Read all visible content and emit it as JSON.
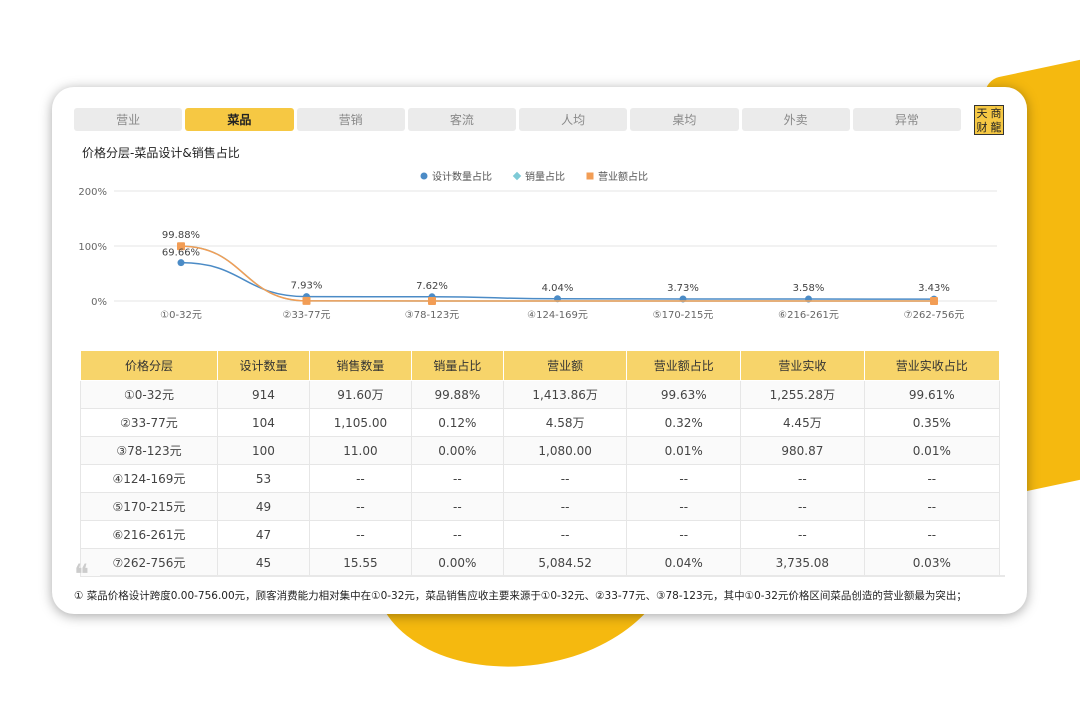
{
  "tabs": [
    "营业",
    "菜品",
    "营销",
    "客流",
    "人均",
    "桌均",
    "外卖",
    "异常"
  ],
  "active_tab": "菜品",
  "logo": [
    "天",
    "商",
    "财",
    "龍"
  ],
  "section_title": "价格分层-菜品设计&销售占比",
  "chart_data": {
    "type": "line",
    "categories": [
      "①0-32元",
      "②33-77元",
      "③78-123元",
      "④124-169元",
      "⑤170-215元",
      "⑥216-261元",
      "⑦262-756元"
    ],
    "series": [
      {
        "name": "设计数量占比",
        "type": "line",
        "color": "#4b8bc6",
        "values": [
          69.66,
          7.93,
          7.62,
          4.04,
          3.73,
          3.58,
          3.43
        ],
        "labels": [
          "69.66%",
          "7.93%",
          "7.62%",
          "4.04%",
          "3.73%",
          "3.58%",
          "3.43%"
        ]
      },
      {
        "name": "销量占比",
        "type": "line",
        "color": "#7ecad6",
        "values": [
          99.88,
          0.12,
          0.0,
          null,
          null,
          null,
          0.0
        ]
      },
      {
        "name": "营业额占比",
        "type": "line",
        "color": "#f29d55",
        "values": [
          99.63,
          0.32,
          0.01,
          null,
          null,
          null,
          0.04
        ],
        "labels": [
          "99.88%"
        ]
      }
    ],
    "yticks": [
      "200%",
      "100%",
      "0%"
    ],
    "ylim": [
      0,
      200
    ],
    "legend_position": "top-center"
  },
  "table": {
    "headers": [
      "价格分层",
      "设计数量",
      "销售数量",
      "销量占比",
      "营业额",
      "营业额占比",
      "营业实收",
      "营业实收占比"
    ],
    "rows": [
      [
        "①0-32元",
        "914",
        "91.60万",
        "99.88%",
        "1,413.86万",
        "99.63%",
        "1,255.28万",
        "99.61%"
      ],
      [
        "②33-77元",
        "104",
        "1,105.00",
        "0.12%",
        "4.58万",
        "0.32%",
        "4.45万",
        "0.35%"
      ],
      [
        "③78-123元",
        "100",
        "11.00",
        "0.00%",
        "1,080.00",
        "0.01%",
        "980.87",
        "0.01%"
      ],
      [
        "④124-169元",
        "53",
        "--",
        "--",
        "--",
        "--",
        "--",
        "--"
      ],
      [
        "⑤170-215元",
        "49",
        "--",
        "--",
        "--",
        "--",
        "--",
        "--"
      ],
      [
        "⑥216-261元",
        "47",
        "--",
        "--",
        "--",
        "--",
        "--",
        "--"
      ],
      [
        "⑦262-756元",
        "45",
        "15.55",
        "0.00%",
        "5,084.52",
        "0.04%",
        "3,735.08",
        "0.03%"
      ]
    ]
  },
  "note": "① 菜品价格设计跨度0.00-756.00元，顾客消费能力相对集中在①0-32元，菜品销售应收主要来源于①0-32元、②33-77元、③78-123元，其中①0-32元价格区间菜品创造的营业额最为突出；"
}
